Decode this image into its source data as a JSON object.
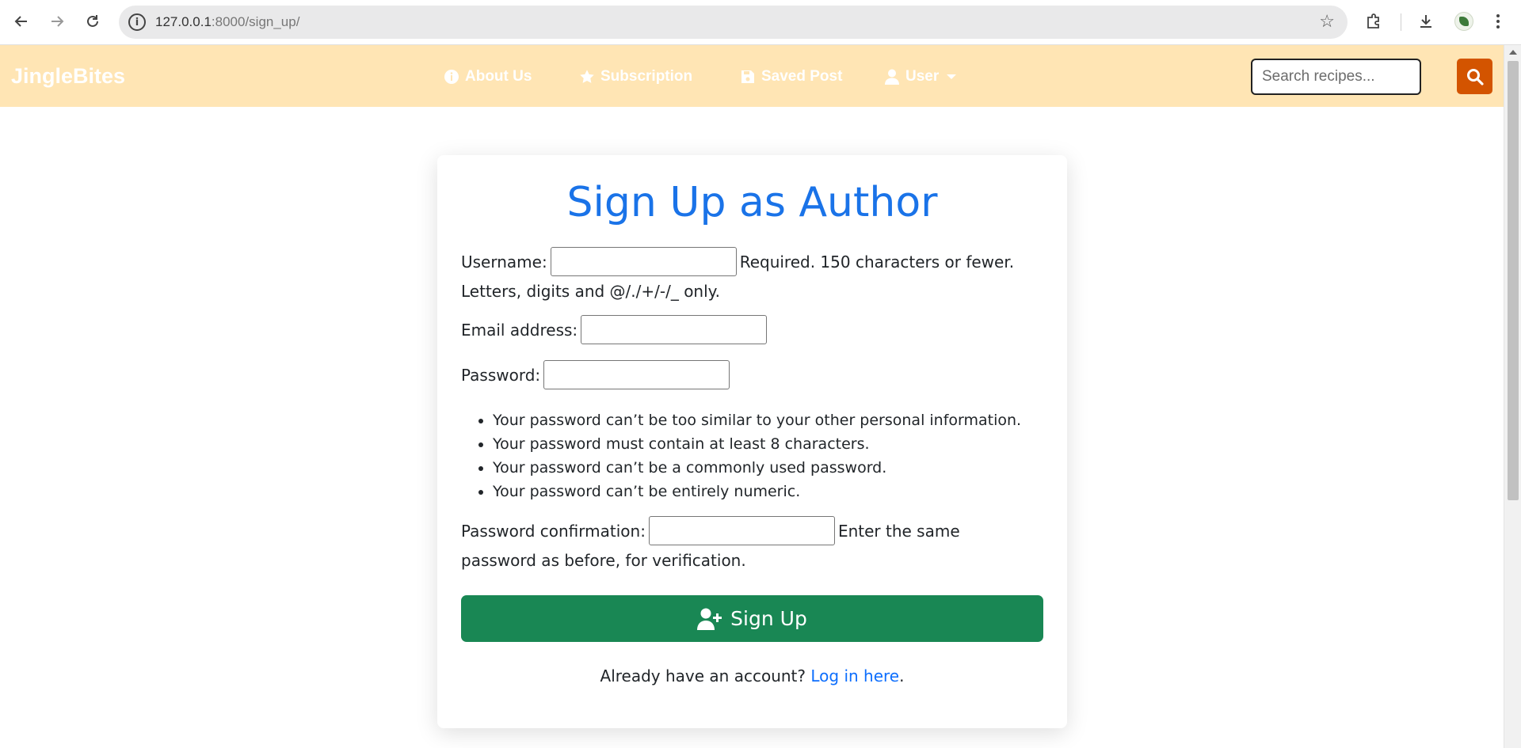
{
  "browser": {
    "url_host": "127.0.0.1",
    "url_rest": ":8000/sign_up/",
    "back_icon": "arrow-left-icon",
    "forward_icon": "arrow-right-icon",
    "reload_icon": "reload-icon"
  },
  "navbar": {
    "brand": "JingleBites",
    "items": [
      {
        "label": "About Us",
        "icon": "info-circle-icon"
      },
      {
        "label": "Subscription",
        "icon": "star-icon"
      },
      {
        "label": "Saved Post",
        "icon": "save-icon"
      },
      {
        "label": "User",
        "icon": "user-icon"
      }
    ],
    "search_placeholder": "Search recipes...",
    "colors": {
      "background": "#ffe5b4",
      "search_button": "#d35400"
    }
  },
  "form": {
    "title": "Sign Up as Author",
    "username_label": "Username:",
    "username_help": "Required. 150 characters or fewer. Letters, digits and @/./+/-/_ only.",
    "email_label": "Email address:",
    "password_label": "Password:",
    "password_help": [
      "Your password can’t be too similar to your other personal information.",
      "Your password must contain at least 8 characters.",
      "Your password can’t be a commonly used password.",
      "Your password can’t be entirely numeric."
    ],
    "confirm_label": "Password confirmation:",
    "confirm_help": "Enter the same password as before, for verification.",
    "submit_label": "Sign Up",
    "login_prompt": "Already have an account?",
    "login_link": "Log in here",
    "login_suffix": ".",
    "colors": {
      "title": "#1a73e8",
      "submit": "#198754",
      "link": "#0d6efd"
    }
  }
}
